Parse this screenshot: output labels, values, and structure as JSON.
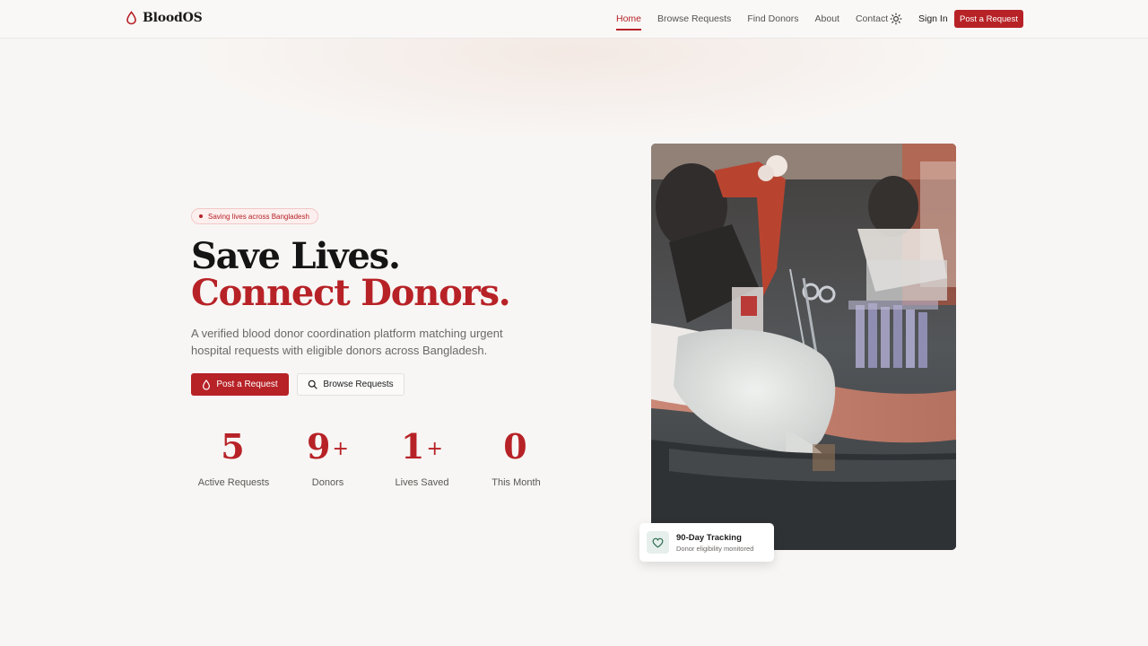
{
  "brand": {
    "name": "BloodOS"
  },
  "nav": {
    "links": [
      {
        "label": "Home"
      },
      {
        "label": "Browse Requests"
      },
      {
        "label": "Find Donors"
      },
      {
        "label": "About"
      },
      {
        "label": "Contact"
      }
    ],
    "sign_in": "Sign In",
    "cta": "Post a Request",
    "theme_icon": "sun-icon"
  },
  "hero": {
    "badge": "Saving lives across Bangladesh",
    "headline_line1": "Save Lives.",
    "headline_line2": "Connect Donors.",
    "subtitle": "A verified blood donor coordination platform matching urgent hospital requests with eligible donors across Bangladesh.",
    "primary_button": "Post a Request",
    "secondary_button": "Browse Requests",
    "stats": [
      {
        "value": "5",
        "suffix": "",
        "label": "Active Requests"
      },
      {
        "value": "9",
        "suffix": "+",
        "label": "Donors"
      },
      {
        "value": "1",
        "suffix": "+",
        "label": "Lives Saved"
      },
      {
        "value": "0",
        "suffix": "",
        "label": "This Month"
      }
    ]
  },
  "info_card": {
    "title": "90-Day Tracking",
    "subtitle": "Donor eligibility monitored",
    "icon": "heart-icon"
  },
  "colors": {
    "accent": "#b72227",
    "background": "#f8f6f4",
    "heading": "#141414"
  }
}
